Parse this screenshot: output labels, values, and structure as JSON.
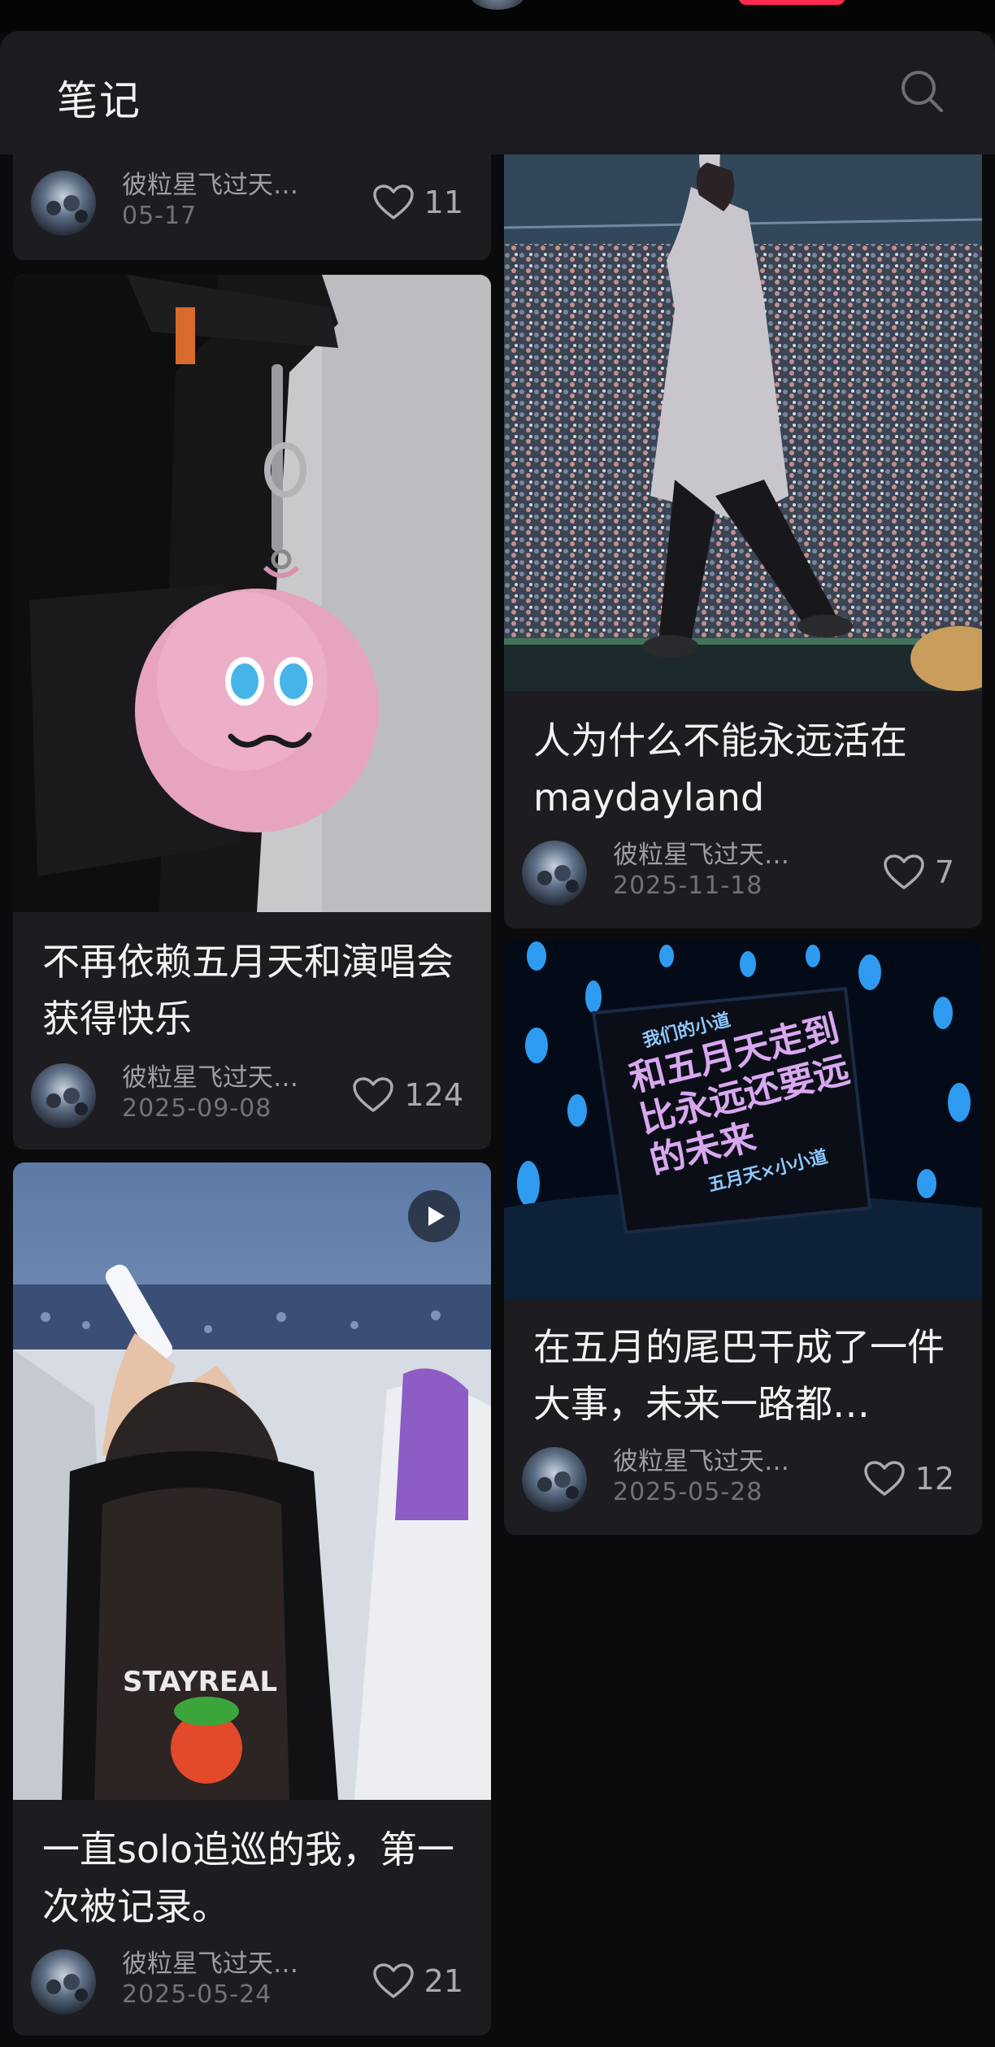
{
  "header": {
    "title": "笔记",
    "search_icon": "search-icon"
  },
  "colors": {
    "background": "#0b0b0d",
    "card": "#1c1c21",
    "accent": "#ff2b4f",
    "header": "#1b1b20"
  },
  "cards": [
    {
      "title": "",
      "author": "彼粒星飞过天…",
      "date": "05-17",
      "likes": "11"
    },
    {
      "title": "不再依赖五月天和演唱会获得快乐",
      "author": "彼粒星飞过天…",
      "date": "2025-09-08",
      "likes": "124"
    },
    {
      "title": "一直solo追巡的我，第一次被记录。",
      "author": "彼粒星飞过天…",
      "date": "2025-05-24",
      "likes": "21",
      "is_video": true
    },
    {
      "title": "人为什么不能永远活在maydayland",
      "author": "彼粒星飞过天…",
      "date": "2025-11-18",
      "likes": "7"
    },
    {
      "title": "在五月的尾巴干成了一件大事，未来一路都…",
      "author": "彼粒星飞过天…",
      "date": "2025-05-28",
      "likes": "12"
    }
  ],
  "image_texts": {
    "shirt": "STAYREAL",
    "sign_top": "我们的小道",
    "sign_line1": "和五月天走到",
    "sign_line2": "比永远还要远",
    "sign_line3": "的未来",
    "sign_bottom": "五月天×小小道"
  }
}
